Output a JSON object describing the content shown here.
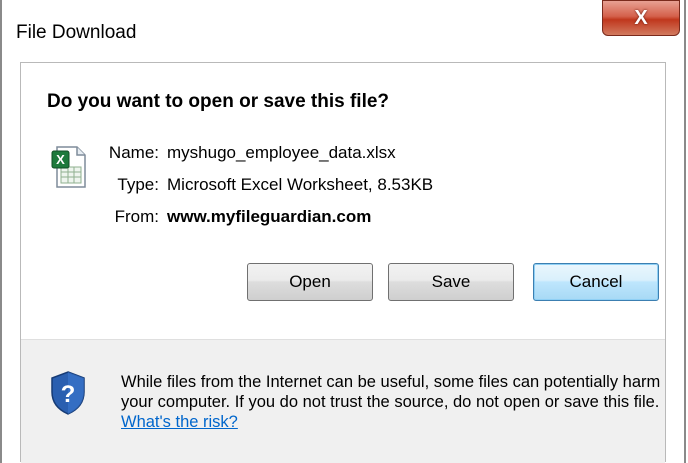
{
  "window": {
    "title": "File Download",
    "close_label": "X"
  },
  "dialog": {
    "question": "Do you want to open or save this file?",
    "file": {
      "name_label": "Name:",
      "name_value": "myshugo_employee_data.xlsx",
      "type_label": "Type:",
      "type_value": "Microsoft Excel Worksheet, 8.53KB",
      "from_label": "From:",
      "from_value": "www.myfileguardian.com"
    },
    "buttons": {
      "open": "Open",
      "save": "Save",
      "cancel": "Cancel"
    },
    "warning": {
      "text": "While files from the Internet can be useful, some files can potentially harm your computer. If you do not trust the source, do not open or save this file. ",
      "link": "What's the risk?"
    }
  },
  "icons": {
    "file_icon": "excel-file-icon",
    "security_icon": "shield-question-icon"
  },
  "colors": {
    "close_button": "#c0371d",
    "link": "#0066cc",
    "default_button_border": "#3c7fb1"
  }
}
